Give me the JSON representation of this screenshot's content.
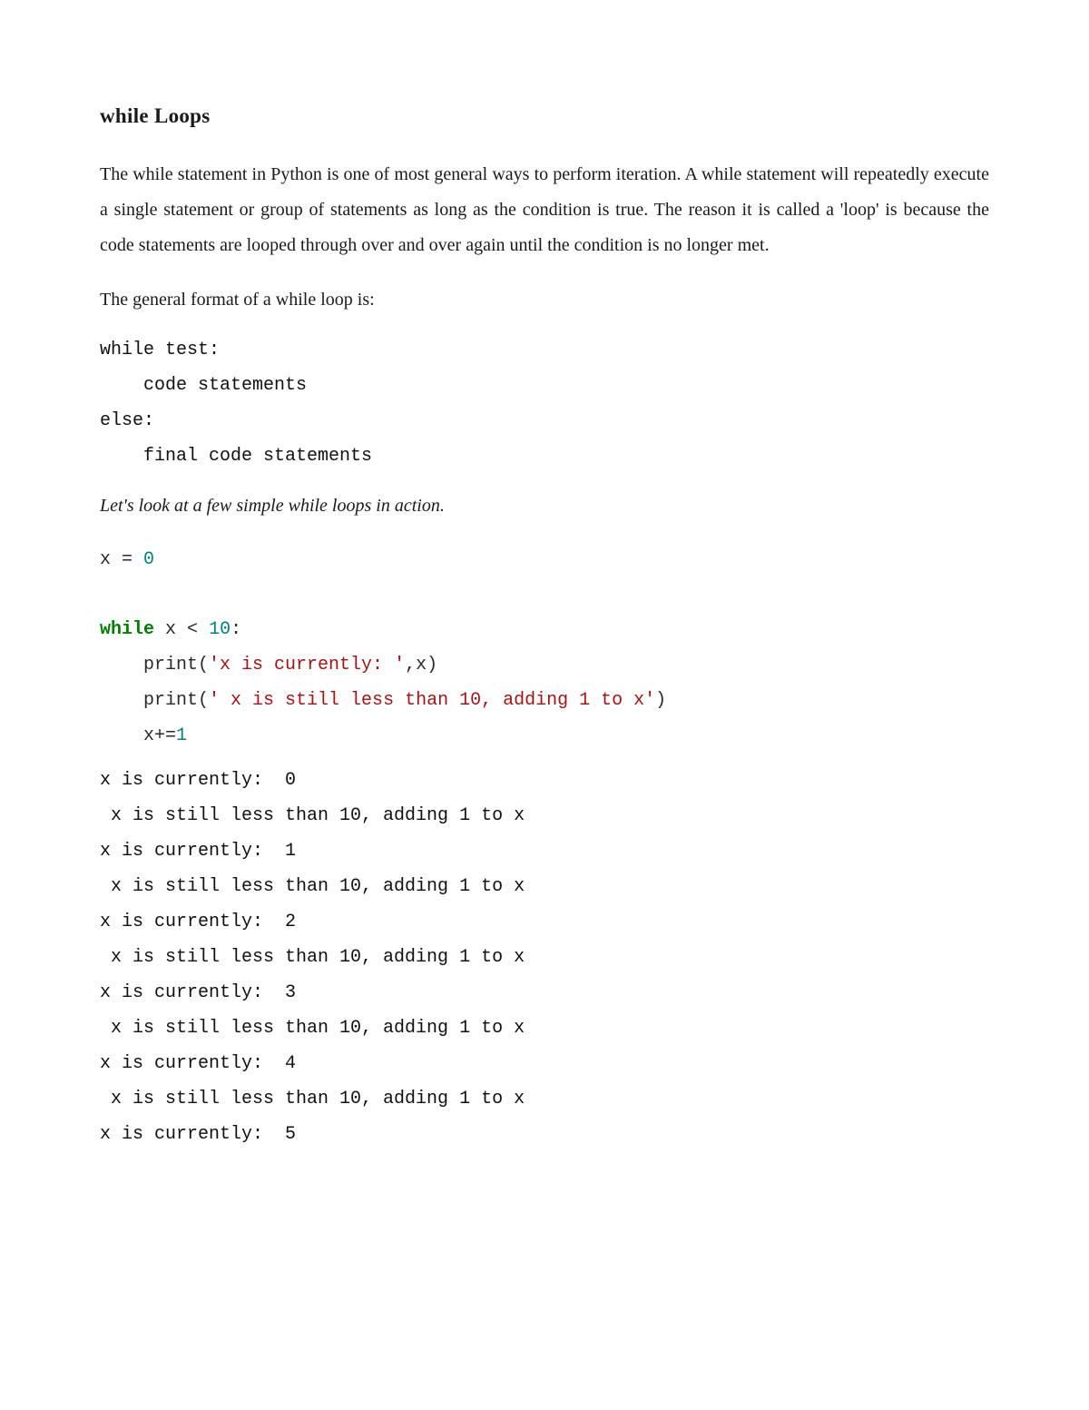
{
  "heading": "while Loops",
  "para1": "The while statement in Python is one of most general ways to perform iteration. A while statement will repeatedly execute a single statement or group of statements as long as the condition is true. The reason it is called a 'loop' is because the code statements are looped through over and over again until the condition is no longer met.",
  "para2": "The general format of a while loop is:",
  "format_code": "while test:\n    code statements\nelse:\n    final code statements",
  "emph": "Let's look at a few simple while loops in action.",
  "code_line1": {
    "a": "x ",
    "op": "=",
    "b": " ",
    "num": "0"
  },
  "code_loop": {
    "while": "while",
    "cond_a": " x ",
    "lt": "<",
    "cond_b": " ",
    "ten": "10",
    "colon": ":",
    "l2a": "    print(",
    "l2s": "'x is currently: '",
    "l2b": ",x)",
    "l3a": "    print(",
    "l3s": "' x is still less than 10, adding 1 to x'",
    "l3b": ")",
    "l4a": "    x",
    "l4op": "+=",
    "l4num": "1"
  },
  "output": "x is currently:  0\n x is still less than 10, adding 1 to x\nx is currently:  1\n x is still less than 10, adding 1 to x\nx is currently:  2\n x is still less than 10, adding 1 to x\nx is currently:  3\n x is still less than 10, adding 1 to x\nx is currently:  4\n x is still less than 10, adding 1 to x\nx is currently:  5"
}
